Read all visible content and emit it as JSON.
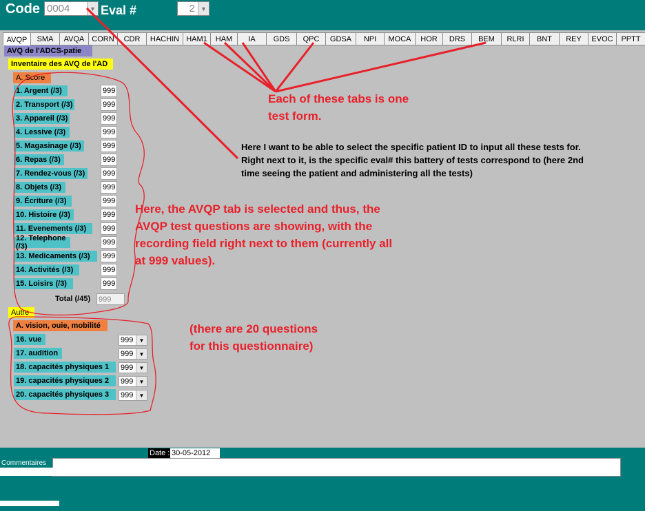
{
  "header": {
    "code_label": "Code",
    "code_value": "0004",
    "eval_label": "Eval #",
    "eval_value": "2"
  },
  "tabs": [
    "AVQP",
    "SMA",
    "AVQA",
    "CORN",
    "CDR",
    "HACHIN",
    "HAM1",
    "HAM",
    "IA",
    "GDS",
    "QPC",
    "GDSA",
    "NPI",
    "MOCA",
    "HOR",
    "DRS",
    "BEM",
    "RLRI",
    "BNT",
    "REY",
    "EVOC",
    "PPTT"
  ],
  "form": {
    "title": "AVQ de l'ADCS-patie",
    "subtitle": "Inventaire des AVQ de l'AD",
    "section_score": "A. Score",
    "questions": [
      {
        "label": "1. Argent (/3)",
        "value": "999"
      },
      {
        "label": "2. Transport (/3)",
        "value": "999"
      },
      {
        "label": "3. Appareil (/3)",
        "value": "999"
      },
      {
        "label": "4. Lessive (/3)",
        "value": "999"
      },
      {
        "label": "5. Magasinage (/3)",
        "value": "999"
      },
      {
        "label": "6. Repas (/3)",
        "value": "999"
      },
      {
        "label": "7. Rendez-vous (/3)",
        "value": "999"
      },
      {
        "label": "8. Objets (/3)",
        "value": "999"
      },
      {
        "label": "9. Écriture (/3)",
        "value": "999"
      },
      {
        "label": "10. Histoire (/3)",
        "value": "999"
      },
      {
        "label": "11. Evenements (/3)",
        "value": "999"
      },
      {
        "label": "12. Telephone (/3)",
        "value": "999"
      },
      {
        "label": "13. Medicaments (/3)",
        "value": "999"
      },
      {
        "label": "14. Activités (/3)",
        "value": "999"
      },
      {
        "label": "15. Loisirs (/3)",
        "value": "999"
      }
    ],
    "total_label": "Total (/45)",
    "total_value": "999",
    "section_other": "Autre",
    "section_vision": "A. vision, ouie, mobilité",
    "other_questions": [
      {
        "label": "16. vue",
        "value": "999"
      },
      {
        "label": "17. audition",
        "value": "999"
      },
      {
        "label": "18. capacités physiques 1",
        "value": "999"
      },
      {
        "label": "19. capacités physiques 2",
        "value": "999"
      },
      {
        "label": "20. capacités physiques 3",
        "value": "999"
      }
    ]
  },
  "annotations": {
    "tabs_note": "Each of these tabs is one\ntest form.",
    "id_note": "Here I want to be able to select the specific patient ID to input all these tests for.\nRight next to it, is the specific eval# this battery of tests correspond to (here 2nd\ntime seeing the patient and administering all the tests)",
    "avqp_note": "Here, the AVQP tab is selected and thus, the\nAVQP test questions are showing, with the\nrecording field right next to them (currently all\nat 999 values).",
    "count_note": "(there are 20 questions\nfor this questionnaire)",
    "color": "#e8202a"
  },
  "footer": {
    "date_label": "Date :",
    "date_value": "30-05-2012",
    "comments_label": "Commentaires"
  }
}
